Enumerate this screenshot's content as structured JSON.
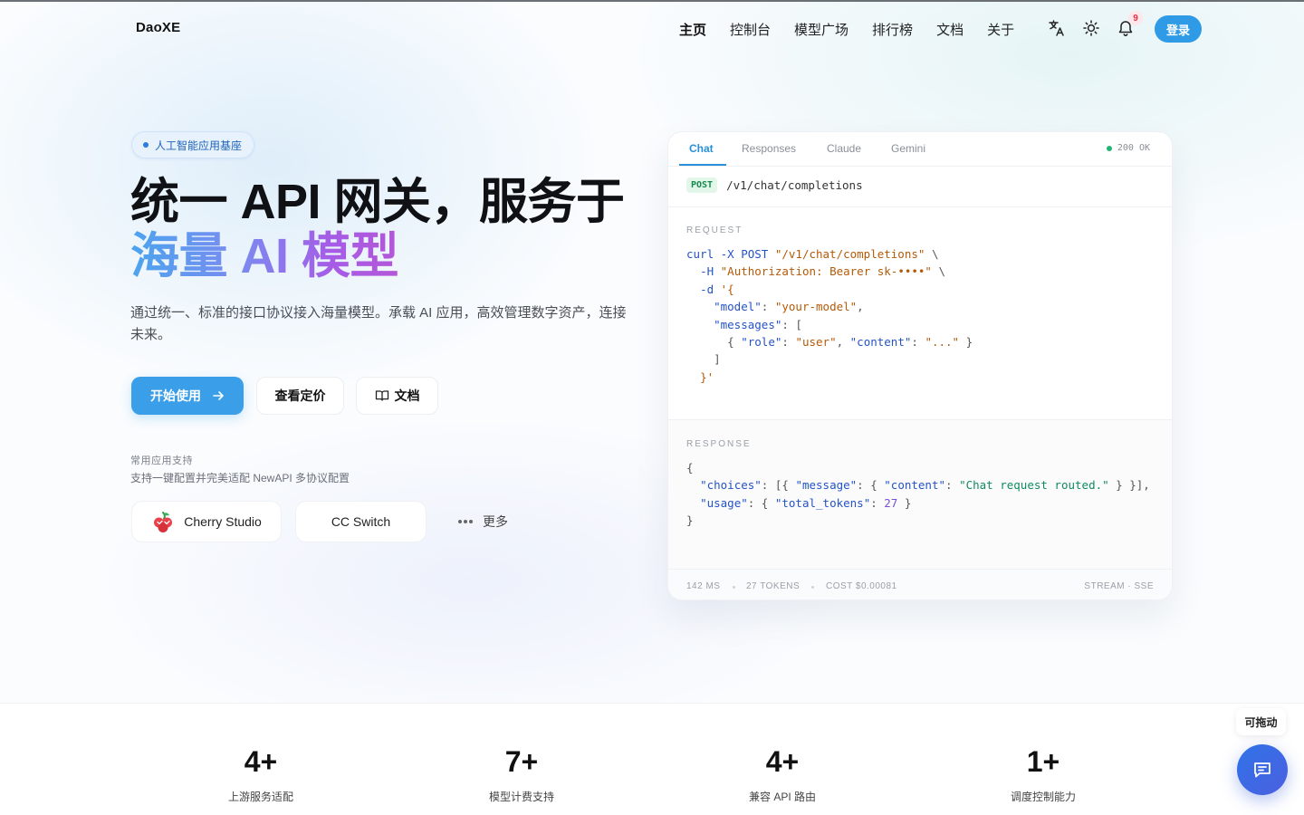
{
  "header": {
    "brand": "DaoXE",
    "nav": [
      "主页",
      "控制台",
      "模型广场",
      "排行榜",
      "文档",
      "关于"
    ],
    "notification_count": "9",
    "login_label": "登录"
  },
  "hero": {
    "badge": "人工智能应用基座",
    "title_line1": "统一 API 网关，服务于",
    "title_line2": "海量 AI 模型",
    "subtitle": "通过统一、标准的接口协议接入海量模型。承载 AI 应用，高效管理数字资产，连接未来。",
    "buttons": {
      "start": "开始使用",
      "pricing": "查看定价",
      "docs": "文档"
    },
    "apps_title": "常用应用支持",
    "apps_subtitle": "支持一键配置并完美适配 NewAPI 多协议配置",
    "apps": [
      "Cherry Studio",
      "CC Switch",
      "更多"
    ]
  },
  "code_card": {
    "tabs": [
      "Chat",
      "Responses",
      "Claude",
      "Gemini"
    ],
    "status": "200 OK",
    "method": "POST",
    "path": "/v1/chat/completions",
    "request_label": "REQUEST",
    "response_label": "RESPONSE",
    "footer": {
      "latency": "142 MS",
      "tokens": "27 TOKENS",
      "cost": "COST $0.00081",
      "stream": "STREAM · SSE"
    }
  },
  "stats": [
    {
      "value": "4+",
      "label": "上游服务适配"
    },
    {
      "value": "7+",
      "label": "模型计费支持"
    },
    {
      "value": "4+",
      "label": "兼容 API 路由"
    },
    {
      "value": "1+",
      "label": "调度控制能力"
    }
  ],
  "floating": {
    "drag_tip": "可拖动"
  },
  "colors": {
    "primary": "#3b9ee8",
    "accent_gradient_start": "#4ba4ee",
    "accent_gradient_end": "#b456d8",
    "status_green": "#22b573"
  }
}
